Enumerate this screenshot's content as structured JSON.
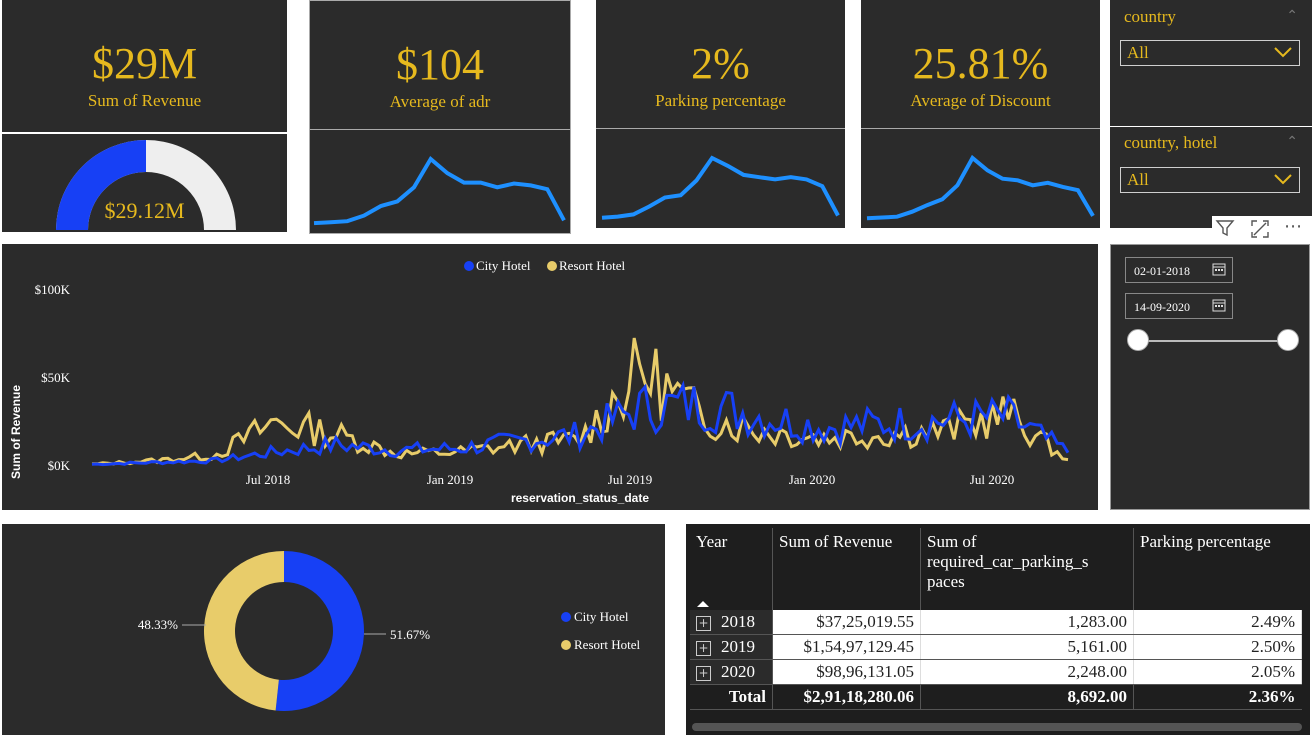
{
  "kpis": [
    {
      "value": "$29M",
      "label": "Sum of Revenue"
    },
    {
      "value": "$104",
      "label": "Average of adr"
    },
    {
      "value": "2%",
      "label": "Parking percentage"
    },
    {
      "value": "25.81%",
      "label": "Average of Discount"
    }
  ],
  "gauge": {
    "value_label": "$29.12M",
    "fill_fraction": 0.5,
    "fill_color": "#1740f5",
    "track_color": "#eeeeee"
  },
  "slicers": {
    "country": {
      "title": "country",
      "selected": "All"
    },
    "country_hotel": {
      "title": "country, hotel",
      "selected": "All"
    }
  },
  "date_range": {
    "start": "02-01-2018",
    "end": "14-09-2020"
  },
  "colors": {
    "accent": "#e6b91e",
    "panel": "#2b2b2b",
    "city": "#1740f5",
    "resort": "#e8cc6a",
    "spark": "#1e90ff"
  },
  "icons": {
    "filter": "filter-icon",
    "focus": "expand-icon",
    "more": "more-options-icon",
    "calendar": "calendar-icon"
  },
  "chart_data": [
    {
      "type": "line",
      "legend": [
        "City Hotel",
        "Resort Hotel"
      ],
      "legend_position": "top-center",
      "title": "",
      "xlabel": "reservation_status_date",
      "ylabel": "Sum of Revenue",
      "x_ticks": [
        "Jul 2018",
        "Jan 2019",
        "Jul 2019",
        "Jan 2020",
        "Jul 2020"
      ],
      "y_ticks": [
        "$0K",
        "$50K",
        "$100K"
      ],
      "ylim": [
        0,
        100000
      ],
      "x": [
        "2018-01",
        "2018-03",
        "2018-05",
        "2018-07",
        "2018-09",
        "2018-11",
        "2019-01",
        "2019-03",
        "2019-05",
        "2019-07",
        "2019-09",
        "2019-11",
        "2020-01",
        "2020-03",
        "2020-05",
        "2020-07",
        "2020-09"
      ],
      "series": [
        {
          "name": "City Hotel",
          "values": [
            1000,
            2000,
            3000,
            8000,
            12000,
            9000,
            10000,
            14000,
            18000,
            33000,
            35000,
            28000,
            22000,
            24000,
            26000,
            28000,
            8000
          ]
        },
        {
          "name": "Resort Hotel",
          "values": [
            1000,
            3000,
            6000,
            25000,
            18000,
            7000,
            8000,
            12000,
            15000,
            55000,
            28000,
            20000,
            16000,
            18000,
            20000,
            30000,
            3000
          ]
        }
      ]
    },
    {
      "type": "pie",
      "donut": true,
      "labels": [
        "City Hotel",
        "Resort Hotel"
      ],
      "values": [
        51.67,
        48.33
      ],
      "value_labels": [
        "51.67%",
        "48.33%"
      ],
      "legend": [
        "City Hotel",
        "Resort Hotel"
      ],
      "legend_position": "right"
    },
    {
      "type": "table",
      "columns": [
        "Year",
        "Sum of Revenue",
        "Sum of required_car_parking_spaces",
        "Parking percentage"
      ],
      "column_labels": [
        "Year",
        "Sum of Revenue",
        "Sum of",
        "required_car_parking_s",
        "paces",
        "Parking percentage"
      ],
      "rows": [
        [
          "2018",
          "$37,25,019.55",
          "1,283.00",
          "2.49%"
        ],
        [
          "2019",
          "$1,54,97,129.45",
          "5,161.00",
          "2.50%"
        ],
        [
          "2020",
          "$98,96,131.05",
          "2,248.00",
          "2.05%"
        ]
      ],
      "total": [
        "Total",
        "$2,91,18,280.06",
        "8,692.00",
        "2.36%"
      ]
    }
  ],
  "sparklines": [
    {
      "name": "adr-trend",
      "values": [
        2,
        3,
        4,
        10,
        20,
        25,
        40,
        70,
        55,
        45,
        45,
        40,
        44,
        42,
        38,
        5
      ]
    },
    {
      "name": "parking-trend",
      "values": [
        2,
        3,
        5,
        12,
        20,
        22,
        35,
        55,
        48,
        40,
        38,
        36,
        38,
        36,
        30,
        4
      ]
    },
    {
      "name": "discount-trend",
      "values": [
        2,
        3,
        4,
        10,
        18,
        25,
        42,
        75,
        60,
        50,
        48,
        42,
        45,
        40,
        36,
        5
      ]
    }
  ]
}
